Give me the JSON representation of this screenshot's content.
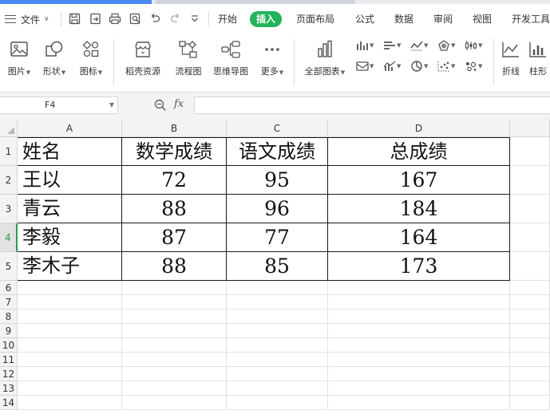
{
  "menubar": {
    "file_label": "文件",
    "tabs": [
      {
        "label": "开始",
        "active": false
      },
      {
        "label": "插入",
        "active": true
      },
      {
        "label": "页面布局",
        "active": false
      },
      {
        "label": "公式",
        "active": false
      },
      {
        "label": "数据",
        "active": false
      },
      {
        "label": "审阅",
        "active": false
      },
      {
        "label": "视图",
        "active": false
      },
      {
        "label": "开发工具",
        "active": false
      }
    ]
  },
  "ribbon": {
    "picture_label": "图片",
    "shape_label": "形状",
    "icon_label": "图标",
    "resource_label": "稻壳资源",
    "flowchart_label": "流程图",
    "mindmap_label": "思维导图",
    "more_label": "更多",
    "allcharts_label": "全部图表",
    "line_label": "折线",
    "column_label": "柱形"
  },
  "formula_bar": {
    "name_box": "F4",
    "fx_label": "fx",
    "formula": ""
  },
  "sheet": {
    "columns": [
      "A",
      "B",
      "C",
      "D"
    ],
    "row_numbers": [
      "1",
      "2",
      "3",
      "4",
      "5",
      "6",
      "7",
      "8",
      "9",
      "10",
      "11",
      "12",
      "13",
      "14"
    ],
    "selected_row": "4",
    "header_row": [
      "姓名",
      "数学成绩",
      "语文成绩",
      "总成绩"
    ],
    "rows": [
      [
        "王以",
        "72",
        "95",
        "167"
      ],
      [
        "青云",
        "88",
        "96",
        "184"
      ],
      [
        "李毅",
        "87",
        "77",
        "164"
      ],
      [
        "李木子",
        "88",
        "85",
        "173"
      ]
    ]
  },
  "colors": {
    "accent_green": "#22b259",
    "grid_line": "#e2e2e2",
    "header_bg": "#f3f3f3"
  }
}
